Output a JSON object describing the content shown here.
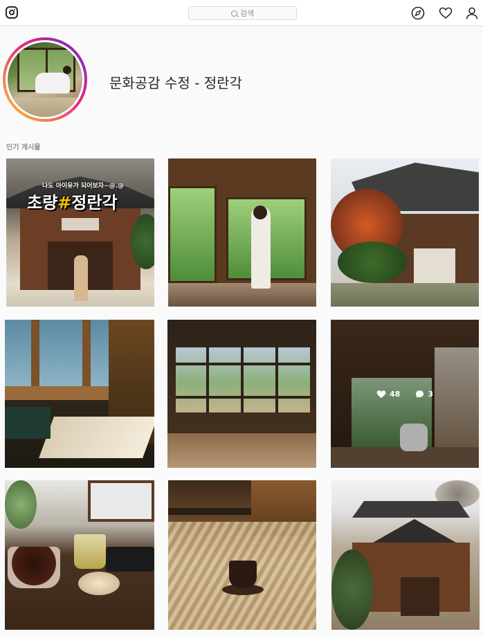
{
  "header": {
    "logo_icon": "instagram-logo-icon",
    "search_placeholder": "검색",
    "nav_icons": [
      "compass-icon",
      "heart-icon",
      "person-icon"
    ]
  },
  "profile": {
    "title": "문화공감 수정 - 정란각",
    "avatar_icon": "location-avatar-image"
  },
  "section": {
    "popular_label": "인기 게시물"
  },
  "posts": [
    {
      "caption_small": "나도 아이유가 되어보자~@.@",
      "caption_large_prefix": "초량",
      "caption_large_hash": "#",
      "caption_large_suffix": "정란각"
    },
    {},
    {},
    {},
    {},
    {
      "likes": "48",
      "comments": "3"
    },
    {},
    {},
    {}
  ],
  "colors": {
    "accent_gradient_start": "#f9ce34",
    "accent_gradient_mid": "#ee2a7b",
    "accent_gradient_end": "#6228d7",
    "caption_highlight": "#f5c400"
  }
}
